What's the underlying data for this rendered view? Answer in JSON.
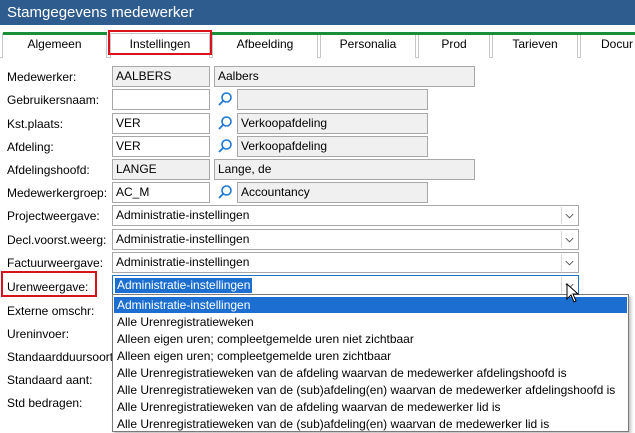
{
  "window": {
    "title": "Stamgegevens medewerker"
  },
  "tabs": [
    {
      "label": "Algemeen"
    },
    {
      "label": "Instellingen"
    },
    {
      "label": "Afbeelding"
    },
    {
      "label": "Personalia"
    },
    {
      "label": "Prod"
    },
    {
      "label": "Tarieven"
    },
    {
      "label": "Docur"
    }
  ],
  "fields": {
    "medewerker": {
      "label": "Medewerker:",
      "code": "AALBERS",
      "description": "Aalbers"
    },
    "gebruikersnaam": {
      "label": "Gebruikersnaam:",
      "code": "",
      "description": ""
    },
    "kstplaats": {
      "label": "Kst.plaats:",
      "code": "VER",
      "description": "Verkoopafdeling"
    },
    "afdeling": {
      "label": "Afdeling:",
      "code": "VER",
      "description": "Verkoopafdeling"
    },
    "afdelingshoofd": {
      "label": "Afdelingshoofd:",
      "code": "LANGE",
      "description": "Lange, de"
    },
    "medewerkergroep": {
      "label": "Medewerkergroep:",
      "code": "AC_M",
      "description": "Accountancy"
    }
  },
  "combos": {
    "projectweergave": {
      "label": "Projectweergave:",
      "value": "Administratie-instellingen"
    },
    "declvoorst": {
      "label": "Decl.voorst.weerg:",
      "value": "Administratie-instellingen"
    },
    "factuurweergave": {
      "label": "Factuurweergave:",
      "value": "Administratie-instellingen"
    },
    "urenweergave": {
      "label": "Urenweergave:",
      "value": "Administratie-instellingen"
    }
  },
  "hidden_labels": {
    "externe_omschr": "Externe omschr:",
    "ureninvoer": "Ureninvoer:",
    "standaardduursoort": "Standaardduursoort:",
    "standaard_aant": "Standaard aant:",
    "std_bedragen": "Std bedragen:"
  },
  "dropdown_options": [
    "Administratie-instellingen",
    "Alle Urenregistratieweken",
    "Alleen eigen uren; compleetgemelde uren niet zichtbaar",
    "Alleen eigen uren; compleetgemelde uren zichtbaar",
    "Alle Urenregistratieweken van de afdeling waarvan de medewerker afdelingshoofd is",
    "Alle Urenregistratieweken van de (sub)afdeling(en) waarvan de medewerker afdelingshoofd is",
    "Alle Urenregistratieweken van de afdeling waarvan de medewerker lid is",
    "Alle Urenregistratieweken van de (sub)afdeling(en) waarvan de medewerker lid is"
  ],
  "colors": {
    "title_bar": "#2f5c8f",
    "highlight_red": "#d9121b",
    "selection_blue": "#1c6fd1",
    "tab_accent_green": "#1a8f3a",
    "search_icon": "#1e78d4"
  },
  "icons": {
    "search": "magnifier-icon",
    "dropdown": "chevron-down-icon"
  }
}
